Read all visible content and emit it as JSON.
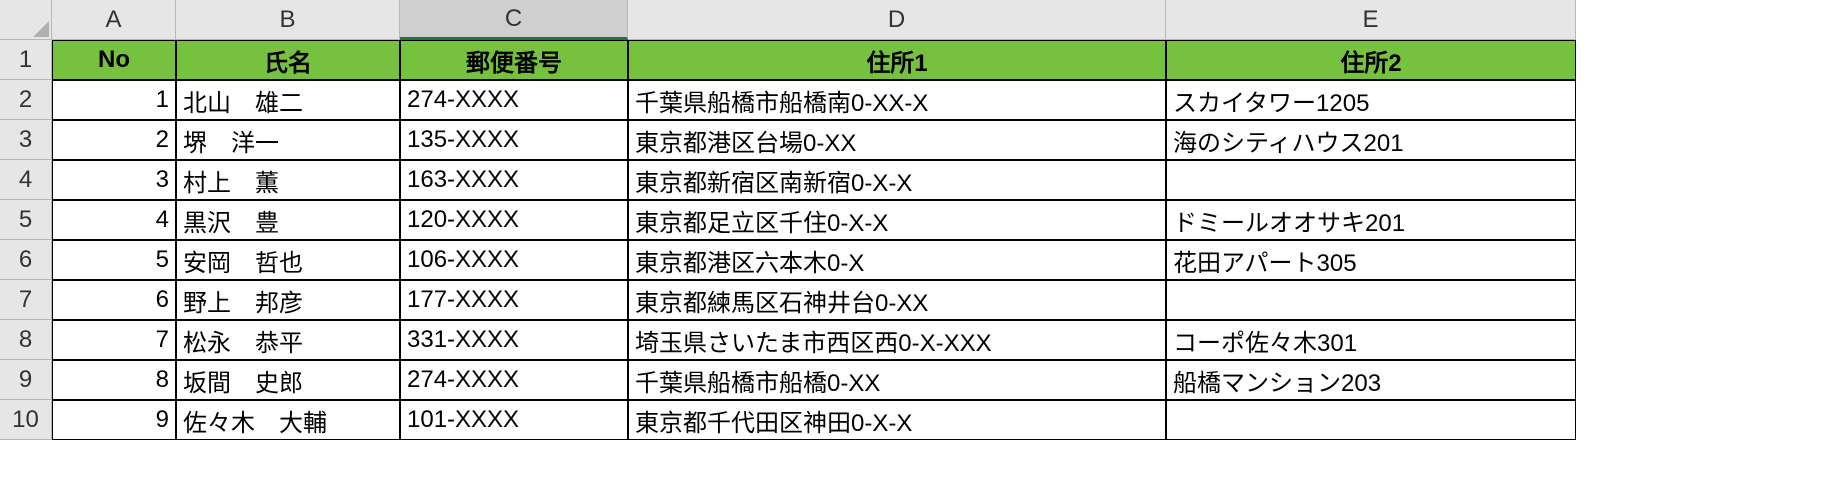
{
  "columns": [
    "A",
    "B",
    "C",
    "D",
    "E"
  ],
  "row_numbers": [
    1,
    2,
    3,
    4,
    5,
    6,
    7,
    8,
    9,
    10
  ],
  "selected_column": "C",
  "header_fill": "#76c13d",
  "headers": {
    "no": "No",
    "name": "氏名",
    "zip": "郵便番号",
    "addr1": "住所1",
    "addr2": "住所2"
  },
  "rows": [
    {
      "no": 1,
      "name": "北山　雄二",
      "zip": "274-XXXX",
      "addr1": "千葉県船橋市船橋南0-XX-X",
      "addr2": "スカイタワー1205"
    },
    {
      "no": 2,
      "name": "堺　洋一",
      "zip": "135-XXXX",
      "addr1": "東京都港区台場0-XX",
      "addr2": "海のシティハウス201"
    },
    {
      "no": 3,
      "name": "村上　薫",
      "zip": "163-XXXX",
      "addr1": "東京都新宿区南新宿0-X-X",
      "addr2": ""
    },
    {
      "no": 4,
      "name": "黒沢　豊",
      "zip": "120-XXXX",
      "addr1": "東京都足立区千住0-X-X",
      "addr2": "ドミールオオサキ201"
    },
    {
      "no": 5,
      "name": "安岡　哲也",
      "zip": "106-XXXX",
      "addr1": "東京都港区六本木0-X",
      "addr2": "花田アパート305"
    },
    {
      "no": 6,
      "name": "野上　邦彦",
      "zip": "177-XXXX",
      "addr1": "東京都練馬区石神井台0-XX",
      "addr2": ""
    },
    {
      "no": 7,
      "name": "松永　恭平",
      "zip": "331-XXXX",
      "addr1": "埼玉県さいたま市西区西0-X-XXX",
      "addr2": "コーポ佐々木301"
    },
    {
      "no": 8,
      "name": "坂間　史郎",
      "zip": "274-XXXX",
      "addr1": "千葉県船橋市船橋0-XX",
      "addr2": "船橋マンション203"
    },
    {
      "no": 9,
      "name": "佐々木　大輔",
      "zip": "101-XXXX",
      "addr1": "東京都千代田区神田0-X-X",
      "addr2": ""
    }
  ]
}
